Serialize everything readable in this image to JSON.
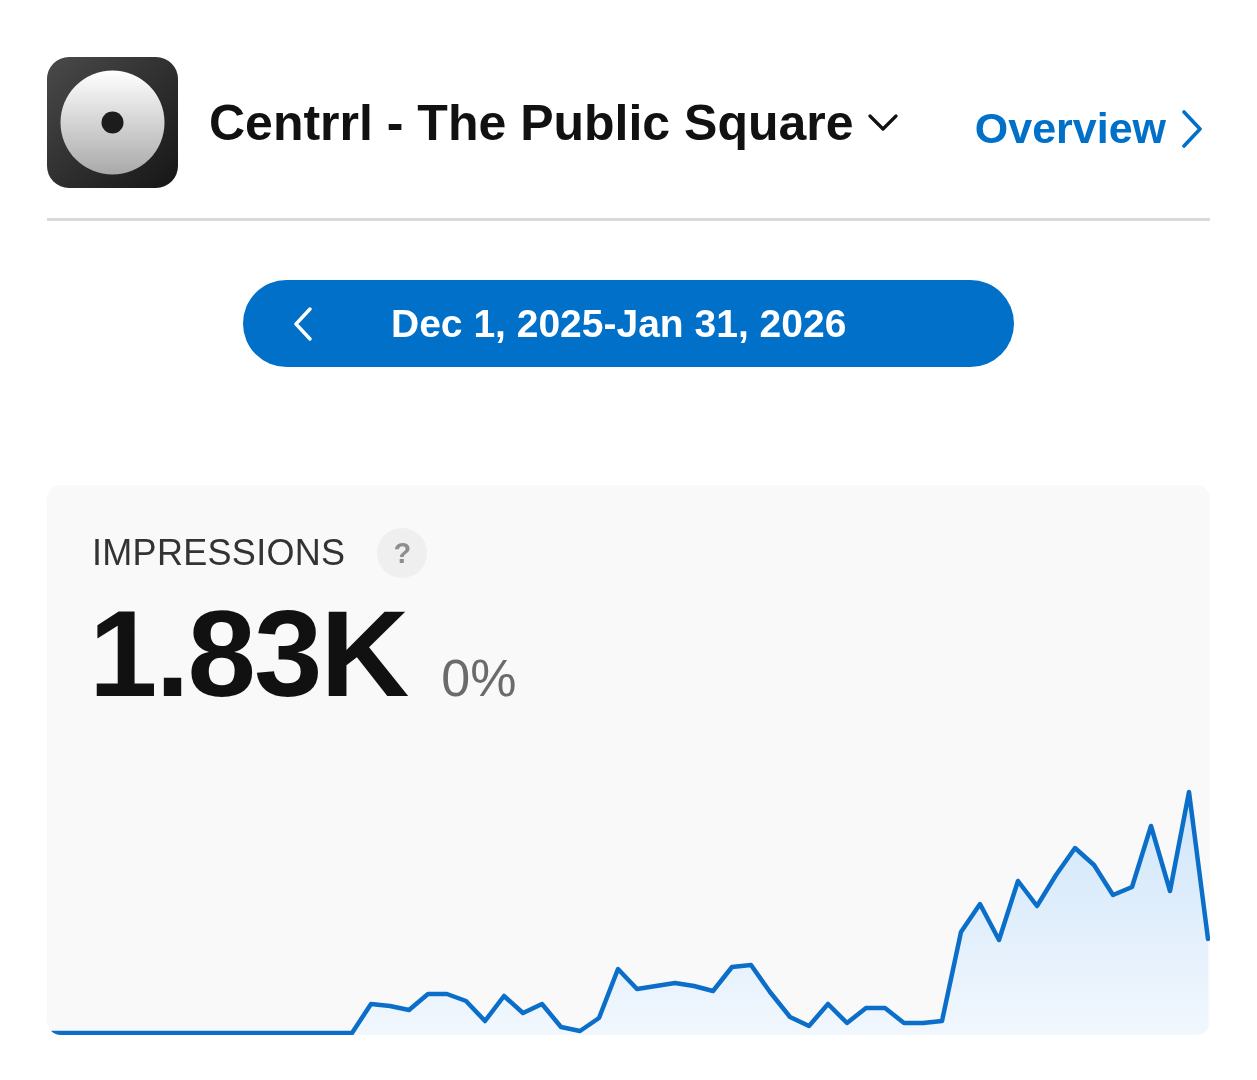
{
  "app": {
    "name": "Centrrl - The Public Square",
    "overview_link": "Overview"
  },
  "date_range": {
    "label": "Dec 1, 2025-Jan 31, 2026"
  },
  "metric": {
    "title": "IMPRESSIONS",
    "help": "?",
    "value": "1.83K",
    "change": "0%"
  }
}
